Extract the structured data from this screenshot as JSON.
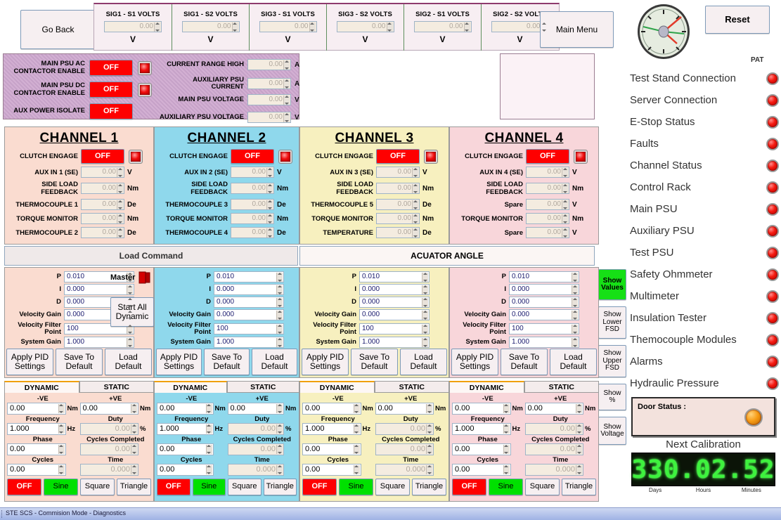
{
  "window": {
    "status_bar": "STE SCS - Commision Mode - Diagnostics"
  },
  "top": {
    "go_back": "Go Back",
    "main_menu": "Main Menu",
    "reset": "Reset",
    "clock_icon": "analog-clock-icon",
    "pat_label": "PAT",
    "signals": [
      {
        "label": "SIG1 - S1 VOLTS",
        "value": "0.00",
        "unit": "V"
      },
      {
        "label": "SIG1 - S2 VOLTS",
        "value": "0.00",
        "unit": "V"
      },
      {
        "label": "SIG3 - S1 VOLTS",
        "value": "0.00",
        "unit": "V"
      },
      {
        "label": "SIG3 - S2 VOLTS",
        "value": "0.00",
        "unit": "V"
      },
      {
        "label": "SIG2 - S1 VOLTS",
        "value": "0.00",
        "unit": "V"
      },
      {
        "label": "SIG2 - S2 VOLTS",
        "value": "0.00",
        "unit": "V"
      }
    ]
  },
  "psu": {
    "toggles": [
      {
        "label": "MAIN PSU AC\nCONTACTOR ENABLE",
        "state": "OFF",
        "has_led": true
      },
      {
        "label": "MAIN PSU DC\nCONTACTOR ENABLE",
        "state": "OFF",
        "has_led": true
      },
      {
        "label": "AUX POWER ISOLATE",
        "state": "OFF",
        "has_led": false
      }
    ],
    "readouts": [
      {
        "label": "CURRENT RANGE HIGH",
        "value": "0.00",
        "unit": "A"
      },
      {
        "label": "AUXILIARY PSU CURRENT",
        "value": "0.00",
        "unit": "A"
      },
      {
        "label": "MAIN PSU VOLTAGE",
        "value": "0.00",
        "unit": "V"
      },
      {
        "label": "AUXILIARY PSU VOLTAGE",
        "value": "0.00",
        "unit": "V"
      }
    ]
  },
  "channels": [
    {
      "title": "CHANNEL 1",
      "bg": "#fadcd0",
      "clutch_label": "CLUTCH ENGAGE",
      "clutch_state": "OFF",
      "readouts": [
        {
          "label": "AUX IN 1 (SE)",
          "value": "0.00",
          "unit": "V"
        },
        {
          "label": "SIDE LOAD FEEDBACK",
          "value": "0.00",
          "unit": "Nm"
        },
        {
          "label": "THERMOCOUPLE 1",
          "value": "0.00",
          "unit": "De"
        },
        {
          "label": "TORQUE MONITOR",
          "value": "0.00",
          "unit": "Nm"
        },
        {
          "label": "THERMOCOUPLE 2",
          "value": "0.00",
          "unit": "De"
        }
      ]
    },
    {
      "title": "CHANNEL 2",
      "bg": "#8fd8ec",
      "clutch_label": "CLUTCH ENGAGE",
      "clutch_state": "OFF",
      "readouts": [
        {
          "label": "AUX IN 2 (SE)",
          "value": "0.00",
          "unit": "V"
        },
        {
          "label": "SIDE LOAD FEEDBACK",
          "value": "0.00",
          "unit": "Nm"
        },
        {
          "label": "THERMOCOUPLE 3",
          "value": "0.00",
          "unit": "De"
        },
        {
          "label": "TORQUE MONITOR",
          "value": "0.00",
          "unit": "Nm"
        },
        {
          "label": "THERMOCOUPLE 4",
          "value": "0.00",
          "unit": "De"
        }
      ]
    },
    {
      "title": "CHANNEL 3",
      "bg": "#f7f0bf",
      "clutch_label": "CLUTCH ENGAGE",
      "clutch_state": "OFF",
      "readouts": [
        {
          "label": "AUX IN 3 (SE)",
          "value": "0.00",
          "unit": "V"
        },
        {
          "label": "SIDE LOAD FEEDBACK",
          "value": "0.00",
          "unit": "Nm"
        },
        {
          "label": "THERMOCOUPLE 5",
          "value": "0.00",
          "unit": "De"
        },
        {
          "label": "TORQUE MONITOR",
          "value": "0.00",
          "unit": "Nm"
        },
        {
          "label": "TEMPERATURE",
          "value": "0.00",
          "unit": "De"
        }
      ]
    },
    {
      "title": "CHANNEL 4",
      "bg": "#f8d6da",
      "clutch_label": "CLUTCH ENGAGE",
      "clutch_state": "OFF",
      "readouts": [
        {
          "label": "AUX IN 4 (SE)",
          "value": "0.00",
          "unit": "V"
        },
        {
          "label": "SIDE LOAD FEEDBACK",
          "value": "0.00",
          "unit": "Nm"
        },
        {
          "label": "Spare",
          "value": "0.00",
          "unit": "V"
        },
        {
          "label": "TORQUE MONITOR",
          "value": "0.00",
          "unit": "Nm"
        },
        {
          "label": "Spare",
          "value": "0.00",
          "unit": "V"
        }
      ]
    }
  ],
  "mode_tabs": {
    "left": "Load Command",
    "right": "ACUATOR ANGLE",
    "active": "ACUATOR ANGLE"
  },
  "pid": {
    "fields": [
      {
        "label": "P",
        "value": "0.010"
      },
      {
        "label": "I",
        "value": "0.000"
      },
      {
        "label": "D",
        "value": "0.000"
      },
      {
        "label": "Velocity Gain",
        "value": "0.000"
      },
      {
        "label": "Velocity Filter\nPoint",
        "value": "100"
      },
      {
        "label": "System Gain",
        "value": "1.000"
      }
    ],
    "buttons": [
      "Apply PID\nSettings",
      "Save To\nDefault",
      "Load\nDefault"
    ],
    "master_label": "Master",
    "master_icon": "book-icon",
    "start_all": "Start All\nDynamic"
  },
  "waveform": {
    "tabs": {
      "dynamic": "DYNAMIC",
      "static": "STATIC",
      "active": "DYNAMIC"
    },
    "left_col": [
      {
        "caption": "-VE",
        "value": "0.00",
        "unit": "Nm",
        "editable": true
      },
      {
        "caption": "Frequency",
        "value": "1.000",
        "unit": "Hz",
        "editable": true
      },
      {
        "caption": "Phase",
        "value": "0.00",
        "unit": "",
        "editable": true
      },
      {
        "caption": "Cycles",
        "value": "0.00",
        "unit": "",
        "editable": true
      }
    ],
    "right_col": [
      {
        "caption": "+VE",
        "value": "0.00",
        "unit": "Nm",
        "editable": true
      },
      {
        "caption": "Duty",
        "value": "0.00",
        "unit": "%",
        "editable": false
      },
      {
        "caption": "Cycles Completed",
        "value": "0.00",
        "unit": "",
        "editable": false
      },
      {
        "caption": "Time",
        "value": "0.000",
        "unit": "",
        "editable": false
      }
    ],
    "buttons": [
      {
        "label": "OFF",
        "style": "red"
      },
      {
        "label": "Sine",
        "style": "green"
      },
      {
        "label": "Square",
        "style": "plain"
      },
      {
        "label": "Triangle",
        "style": "plain"
      }
    ]
  },
  "sidebar": {
    "statuses": [
      {
        "label": "Test Stand Connection",
        "led": "red"
      },
      {
        "label": "Server Connection",
        "led": "red"
      },
      {
        "label": "E-Stop Status",
        "led": "red"
      },
      {
        "label": "Faults",
        "led": "red"
      },
      {
        "label": "Channel Status",
        "led": "red"
      },
      {
        "label": "Control Rack",
        "led": "red"
      },
      {
        "label": "Main PSU",
        "led": "red"
      },
      {
        "label": "Auxiliary PSU",
        "led": "red"
      },
      {
        "label": "Test PSU",
        "led": "red"
      },
      {
        "label": "Safety Ohmmeter",
        "led": "red"
      },
      {
        "label": "Multimeter",
        "led": "red"
      },
      {
        "label": "Insulation Tester",
        "led": "red"
      },
      {
        "label": "Themocouple Modules",
        "led": "red"
      },
      {
        "label": "Alarms",
        "led": "red"
      },
      {
        "label": "Hydraulic Pressure",
        "led": "red"
      }
    ],
    "view_buttons": [
      {
        "label": "Show\nValues",
        "active": true
      },
      {
        "label": "Show\nLower\nFSD",
        "active": false
      },
      {
        "label": "Show\nUpper\nFSD",
        "active": false
      },
      {
        "label": "Show\n%",
        "active": false
      },
      {
        "label": "Show\nVoltage",
        "active": false
      }
    ],
    "door": {
      "label": "Door Status :",
      "led": "amber"
    },
    "calibration": {
      "title": "Next Calibration",
      "display": "330.02.52",
      "units": [
        "Days",
        "Hours",
        "Minutes"
      ]
    }
  },
  "colors": {
    "red_button": "#fe0000",
    "green_button": "#00e000",
    "led_red": "#f51a10",
    "led_amber": "#f79b14",
    "lcd_green": "#3ef23e"
  }
}
